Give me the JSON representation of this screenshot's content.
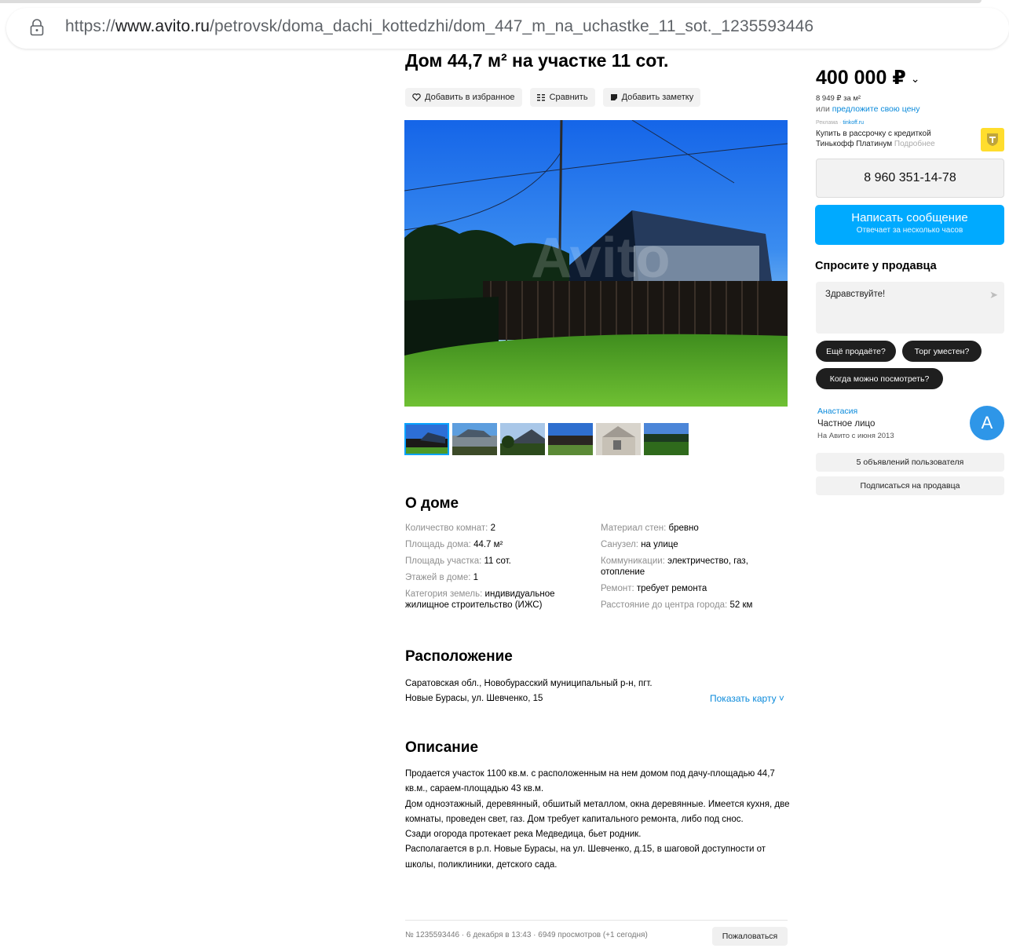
{
  "browser": {
    "url_prefix": "https://",
    "url_host": "www.avito.ru",
    "url_path": "/petrovsk/doma_dachi_kottedzhi/dom_447_m_na_uchastke_11_sot._1235593446",
    "lock_icon": "lock-icon"
  },
  "listing": {
    "title": "Дом 44,7 м² на участке 11 сот.",
    "actions": {
      "favorite": "Добавить в избранное",
      "compare": "Сравнить",
      "note": "Добавить заметку"
    },
    "photo_watermark": "Avito",
    "thumb_count": 6
  },
  "about": {
    "heading": "О доме",
    "left": [
      {
        "k": "Количество комнат: ",
        "v": "2"
      },
      {
        "k": "Площадь дома: ",
        "v": "44.7 м²"
      },
      {
        "k": "Площадь участка: ",
        "v": "11 сот."
      },
      {
        "k": "Этажей в доме: ",
        "v": "1"
      },
      {
        "k": "Категория земель: ",
        "v": "индивидуальное жилищное строительство (ИЖС)"
      }
    ],
    "right": [
      {
        "k": "Материал стен: ",
        "v": "бревно"
      },
      {
        "k": "Санузел: ",
        "v": "на улице"
      },
      {
        "k": "Коммуникации: ",
        "v": "электричество, газ, отопление"
      },
      {
        "k": "Ремонт: ",
        "v": "требует ремонта"
      },
      {
        "k": "Расстояние до центра города: ",
        "v": "52 км"
      }
    ]
  },
  "location": {
    "heading": "Расположение",
    "address_line1": "Саратовская обл., Новобурасский муниципальный р-н, пгт.",
    "address_line2": "Новые Бурасы, ул. Шевченко, 15",
    "show_map": "Показать карту ˅"
  },
  "description": {
    "heading": "Описание",
    "paragraphs": [
      "Продается участок 1100 кв.м. с расположенным на нем домом под дачу-площадью 44,7 кв.м., сараем-площадью 43 кв.м.",
      "Дом одноэтажный, деревянный, обшитый металлом, окна деревянные. Имеется кухня, две комнаты, проведен свет, газ. Дом требует капитального ремонта, либо под снос.",
      "Сзади огорода протекает река Медведица, бьет родник.",
      "Располагается в р.п. Новые Бурасы, на ул. Шевченко, д.15, в шаговой доступности от школы, поликлиники, детского сада."
    ]
  },
  "footer": {
    "meta": "№ 1235593446 · 6 декабря в 13:43 · 6949 просмотров (+1 сегодня)",
    "complain": "Пожаловаться"
  },
  "sidebar": {
    "price": "400 000 ₽",
    "price_per_m2": "8 949 ₽ за м²",
    "offer_prefix": "или ",
    "offer_link": "предложите свою цену",
    "ad_label": "Реклама · ",
    "ad_domain": "tinkoff.ru",
    "ad_text": "Купить в рассрочку с кредиткой Тинькофф Платинум ",
    "ad_more": "Подробнее",
    "phone": "8 960 351-14-78",
    "message_button": "Написать сообщение",
    "message_sub": "Отвечает за несколько часов",
    "ask_heading": "Спросите у продавца",
    "ask_placeholder": "Здравствуйте!",
    "chips": [
      "Ещё продаёте?",
      "Торг уместен?",
      "Когда можно посмотреть?"
    ],
    "seller_name": "Анастасия",
    "seller_type": "Частное лицо",
    "seller_since": "На Авито с июня 2013",
    "avatar_letter": "А",
    "user_ads": "5 объявлений пользователя",
    "subscribe": "Подписаться на продавца"
  },
  "colors": {
    "accent": "#00aaff",
    "link": "#0a8adb",
    "ad_icon": "#ffdd2d",
    "avatar": "#2e96e8"
  }
}
